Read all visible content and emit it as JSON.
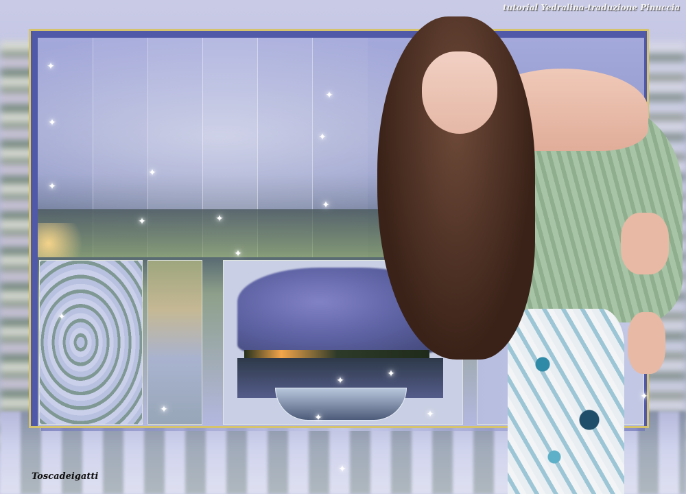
{
  "credits": {
    "top": "tutorial Yedralina-traduzione Pinuccia",
    "bottom": "Toscadeigatti"
  },
  "colors": {
    "frame_border": "#d5c46d",
    "frame_fill": "#5059a8",
    "sky": "#5d62a3",
    "sweater": "#a8c4a6"
  }
}
